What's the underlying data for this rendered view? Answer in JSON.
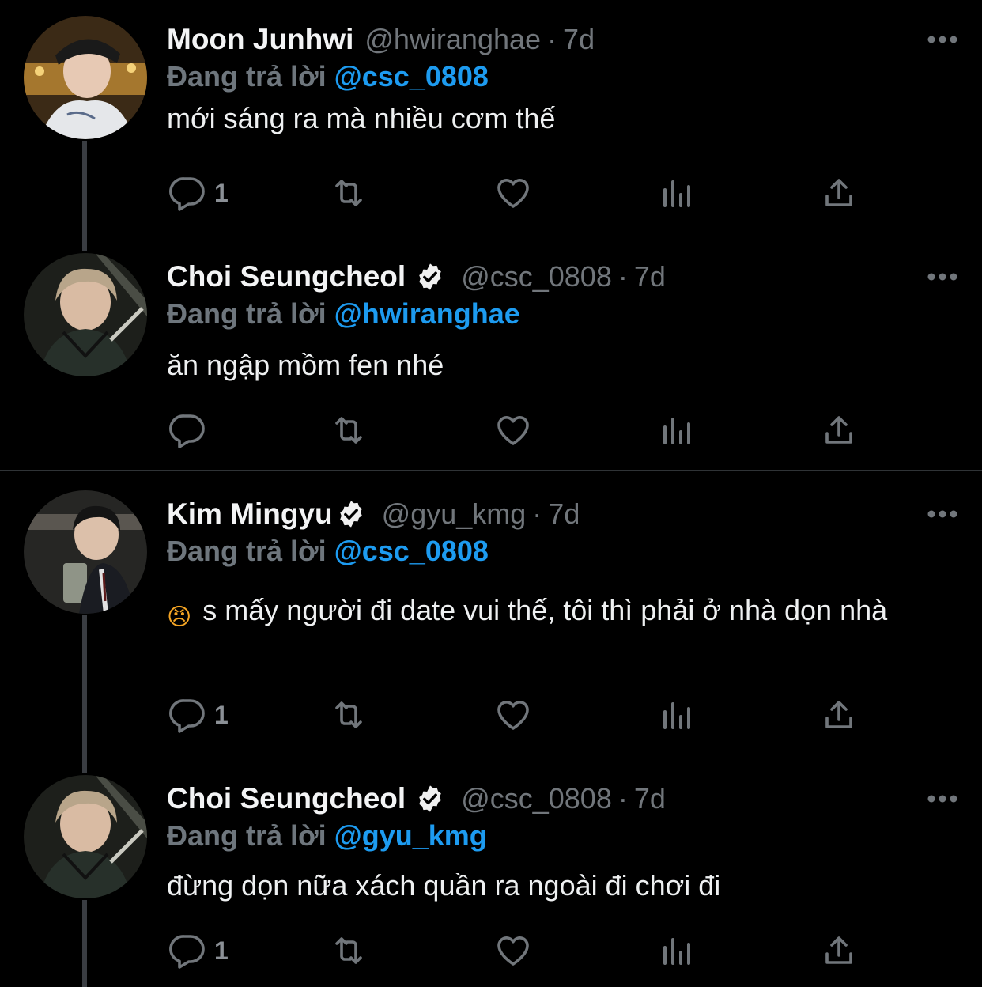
{
  "reply_prefix": "Đang trả lời",
  "tweets": [
    {
      "name": "Moon Junhwi",
      "handle": "@hwiranghae",
      "separator": "·",
      "time": "7d",
      "verified": false,
      "reply_to": "@csc_0808",
      "text": "mới sáng ra mà nhiều cơm thế",
      "reply_count": "1"
    },
    {
      "name": "Choi Seungcheol",
      "handle": "@csc_0808",
      "separator": "·",
      "time": "7d",
      "verified": true,
      "reply_to": "@hwiranghae",
      "text": "ăn ngập mồm fen nhé",
      "reply_count": ""
    },
    {
      "name": "Kim Mingyu",
      "handle": "@gyu_kmg",
      "separator": "·",
      "time": "7d",
      "verified": true,
      "reply_to": "@csc_0808",
      "text": "s mấy người đi date vui thế, tôi thì phải ở nhà dọn nhà",
      "emoji": "😠",
      "reply_count": "1"
    },
    {
      "name": "Choi Seungcheol",
      "handle": "@csc_0808",
      "separator": "·",
      "time": "7d",
      "verified": true,
      "reply_to": "@gyu_kmg",
      "text": "đừng dọn nữa xách quần ra ngoài đi chơi đi",
      "reply_count": "1"
    }
  ],
  "colors": {
    "background": "#000000",
    "mention": "#1d9bf0",
    "muted": "#71767b",
    "thread_line": "#3a3d42"
  }
}
